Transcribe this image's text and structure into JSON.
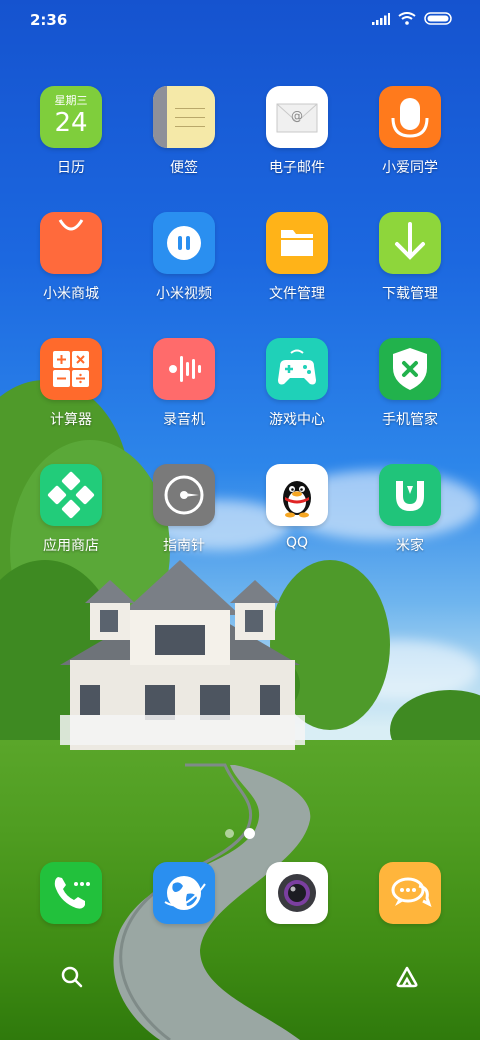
{
  "status_bar": {
    "time": "2:36"
  },
  "calendar_widget": {
    "weekday": "星期三",
    "day": "24"
  },
  "apps": [
    {
      "label": "日历",
      "icon": "calendar-icon"
    },
    {
      "label": "便签",
      "icon": "notes-icon"
    },
    {
      "label": "电子邮件",
      "icon": "email-icon"
    },
    {
      "label": "小爱同学",
      "icon": "assistant-icon"
    },
    {
      "label": "小米商城",
      "icon": "shopping-bag-icon"
    },
    {
      "label": "小米视频",
      "icon": "video-icon"
    },
    {
      "label": "文件管理",
      "icon": "folder-icon"
    },
    {
      "label": "下载管理",
      "icon": "download-icon"
    },
    {
      "label": "计算器",
      "icon": "calculator-icon"
    },
    {
      "label": "录音机",
      "icon": "recorder-icon"
    },
    {
      "label": "游戏中心",
      "icon": "gamepad-icon"
    },
    {
      "label": "手机管家",
      "icon": "security-shield-icon"
    },
    {
      "label": "应用商店",
      "icon": "app-store-icon"
    },
    {
      "label": "指南针",
      "icon": "compass-icon"
    },
    {
      "label": "QQ",
      "icon": "qq-penguin-icon"
    },
    {
      "label": "米家",
      "icon": "mijia-icon"
    }
  ],
  "page_indicator": {
    "pages": 2,
    "current": 2
  },
  "dock": [
    {
      "icon": "phone-icon"
    },
    {
      "icon": "browser-globe-icon"
    },
    {
      "icon": "camera-icon"
    },
    {
      "icon": "messages-icon"
    }
  ],
  "bottom_bar": [
    {
      "icon": "search-icon"
    },
    {
      "icon": "app-vault-icon"
    }
  ],
  "colors": {
    "calendar": "#7fce3c",
    "notes": "#f5e9a8",
    "email": "#ffffff",
    "assistant": "#ff7a1c",
    "mall": "#ff6a3c",
    "video": "#2a8ff0",
    "files": "#ffb318",
    "download": "#8ed63b",
    "calculator": "#ff6a2c",
    "recorder": "#ff6b6b",
    "game": "#1fd1b8",
    "security": "#22b24c",
    "appstore": "#22cc7a",
    "compass": "#7a7a7a",
    "qq": "#ffffff",
    "mijia": "#20c47a",
    "phone": "#22c13c",
    "browser": "#2a8ff0",
    "camera": "#ffffff",
    "messages": "#ffb53c"
  }
}
